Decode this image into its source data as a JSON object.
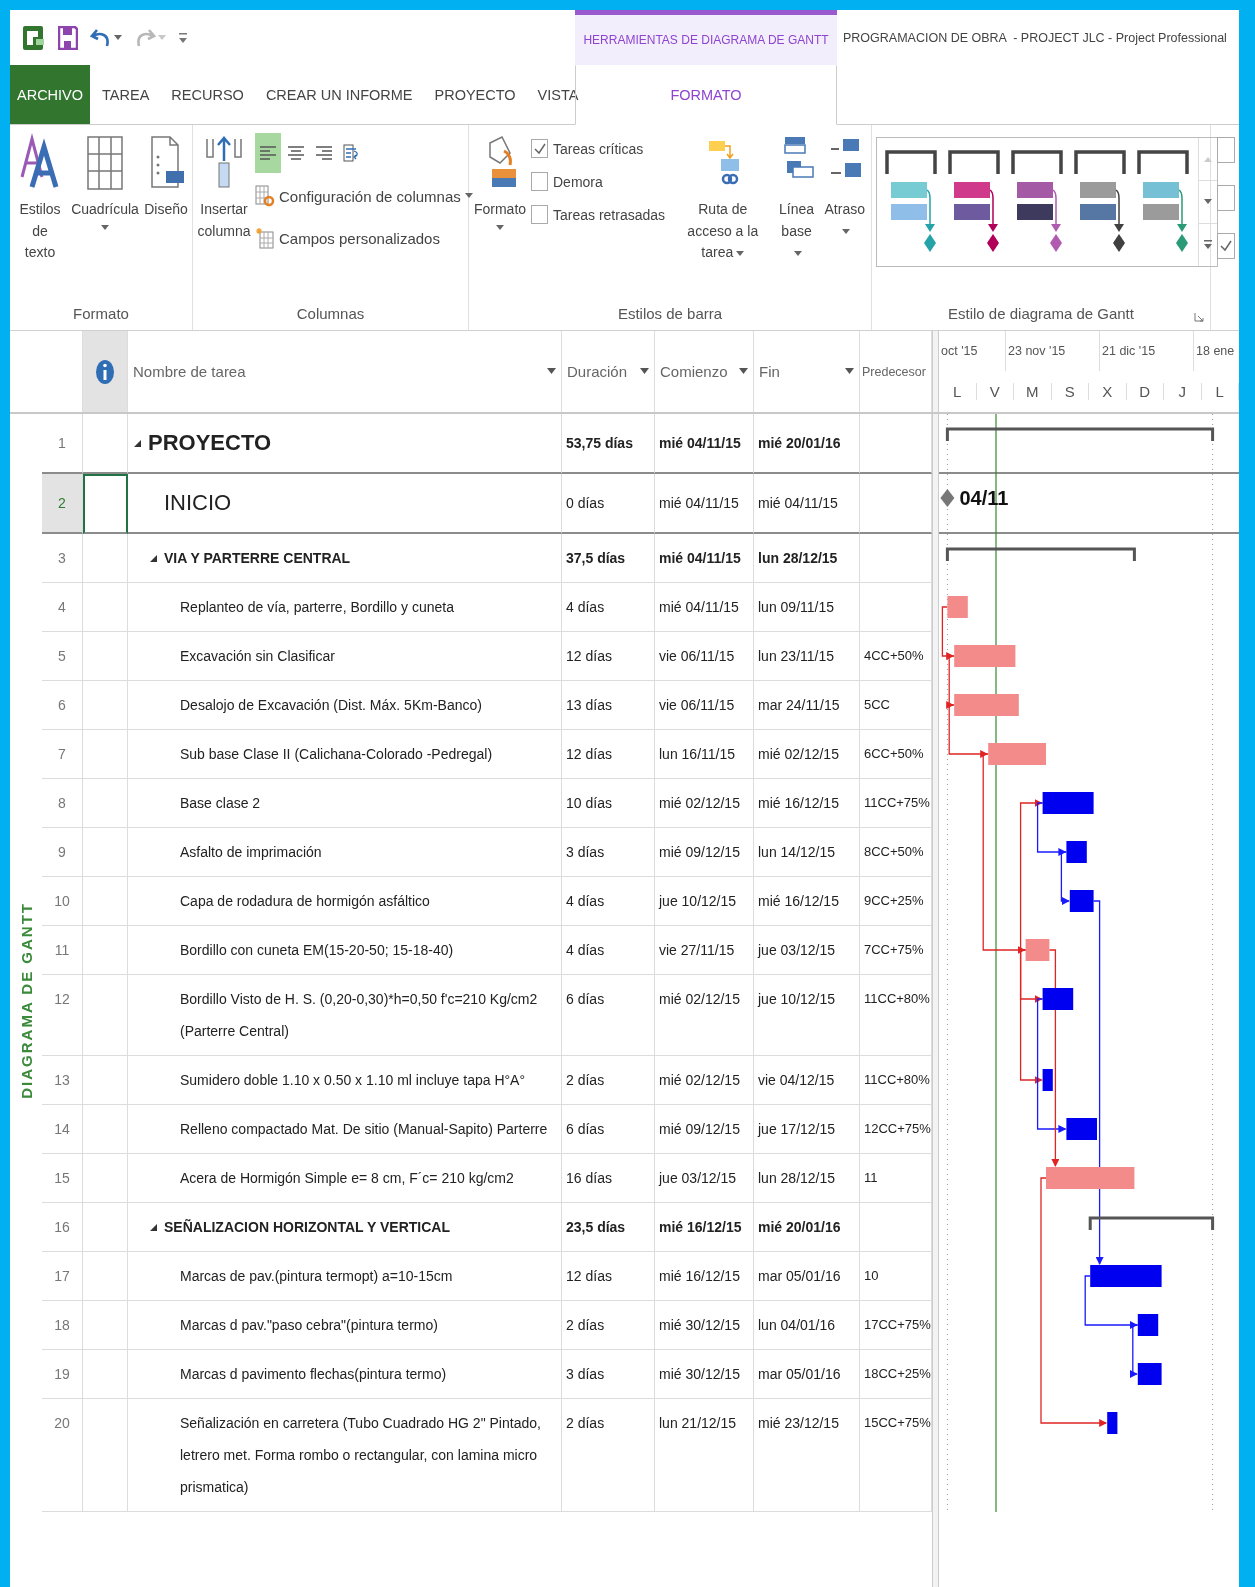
{
  "quick_access_toolbar": {
    "buttons": [
      {
        "kind": "app"
      },
      {
        "kind": "save"
      },
      {
        "kind": "undo",
        "disabled": false
      },
      {
        "kind": "redo",
        "disabled": true
      },
      {
        "kind": "customize"
      }
    ]
  },
  "title_bar": {
    "contextual_group": "HERRAMIENTAS DE DIAGRAMA DE GANTT",
    "title": "PROGRAMACION DE OBRA  - PROJECT JLC - Project Professional"
  },
  "tabs": [
    {
      "label": "ARCHIVO",
      "kind": "file",
      "selected": false
    },
    {
      "label": "TAREA",
      "kind": "standard",
      "selected": false
    },
    {
      "label": "RECURSO",
      "kind": "standard",
      "selected": false
    },
    {
      "label": "CREAR UN INFORME",
      "kind": "standard",
      "selected": false
    },
    {
      "label": "PROYECTO",
      "kind": "standard",
      "selected": false
    },
    {
      "label": "VISTA",
      "kind": "standard",
      "selected": false
    },
    {
      "label": "FORMATO",
      "kind": "contextual",
      "selected": true
    }
  ],
  "ribbon": {
    "format_group": {
      "label": "Formato",
      "buttons": [
        {
          "label": "Estilos de texto",
          "dropdown": false
        },
        {
          "label": "Cuadrícula",
          "dropdown": true
        },
        {
          "label": "Diseño",
          "dropdown": false
        }
      ]
    },
    "columns_group": {
      "label": "Columnas",
      "insert_button": {
        "label": "Insertar columna"
      },
      "align_buttons": [
        {
          "kind": "left",
          "selected": true
        },
        {
          "kind": "center",
          "selected": false
        },
        {
          "kind": "right",
          "selected": false
        },
        {
          "kind": "wrap",
          "selected": false
        }
      ],
      "commands": [
        {
          "label": "Configuración de columnas",
          "dropdown": true
        },
        {
          "label": "Campos personalizados",
          "dropdown": false
        }
      ]
    },
    "bar_styles_group": {
      "label": "Estilos de barra",
      "format_button": {
        "label": "Formato",
        "dropdown": true
      },
      "checkboxes": [
        {
          "label": "Tareas críticas",
          "checked": true
        },
        {
          "label": "Demora",
          "checked": false
        },
        {
          "label": "Tareas retrasadas",
          "checked": false
        }
      ],
      "buttons": [
        {
          "label": "Ruta de acceso a la tarea",
          "dropdown": true
        },
        {
          "label": "Línea base",
          "dropdown": true
        },
        {
          "label": "Atraso",
          "dropdown": true
        }
      ]
    },
    "gantt_style_group": {
      "label": "Estilo de diagrama de Gantt",
      "styles": [
        {
          "swatches": [
            {
              "kind": "task",
              "color": "#76ccd2"
            },
            {
              "kind": "baseline",
              "color": "#8fbfe9"
            },
            {
              "kind": "milestone",
              "color": "#24a3a8"
            }
          ]
        },
        {
          "swatches": [
            {
              "kind": "task",
              "color": "#d03a8a"
            },
            {
              "kind": "baseline",
              "color": "#6e5a9e"
            },
            {
              "kind": "milestone",
              "color": "#b0005a"
            }
          ]
        },
        {
          "swatches": [
            {
              "kind": "task",
              "color": "#a45aa5"
            },
            {
              "kind": "baseline",
              "color": "#3e3a5e"
            },
            {
              "kind": "milestone",
              "color": "#b05ab0"
            }
          ]
        },
        {
          "swatches": [
            {
              "kind": "task",
              "color": "#9b9b9b"
            },
            {
              "kind": "baseline",
              "color": "#5677a3"
            },
            {
              "kind": "milestone",
              "color": "#404040"
            }
          ]
        },
        {
          "swatches": [
            {
              "kind": "task",
              "color": "#76c0d6"
            },
            {
              "kind": "baseline",
              "color": "#9b9b9b"
            },
            {
              "kind": "milestone",
              "color": "#2a9a78"
            }
          ]
        }
      ]
    },
    "overflow_checkboxes": [
      {
        "checked": false
      },
      {
        "checked": false
      },
      {
        "checked": true
      }
    ]
  },
  "view_label": "DIAGRAMA DE GANTT",
  "table": {
    "columns": [
      {
        "label": "Nombre de tarea",
        "filter": true
      },
      {
        "label": "Duración",
        "filter": true
      },
      {
        "label": "Comienzo",
        "filter": true
      },
      {
        "label": "Fin",
        "filter": true
      },
      {
        "label": "Predecesor",
        "filter": false
      }
    ],
    "rows": [
      {
        "id": "1",
        "kind": "summary",
        "large": true,
        "selected": false,
        "name": "PROYECTO",
        "duration": "53,75 días",
        "start": "mié 04/11/15",
        "finish": "mié 20/01/16",
        "children": [
          {
            "id": "2",
            "kind": "milestone",
            "large": true,
            "selected": true,
            "name": "INICIO",
            "duration": "0 días",
            "start": "mié 04/11/15",
            "finish": "mié 04/11/15",
            "gantt_label": "04/11"
          },
          {
            "id": "3",
            "kind": "summary",
            "large": false,
            "selected": false,
            "name": "VIA Y PARTERRE CENTRAL",
            "duration": "37,5 días",
            "start": "mié 04/11/15",
            "finish": "lun 28/12/15",
            "children": [
              {
                "id": "4",
                "kind": "task",
                "critical": true,
                "selected": false,
                "name": "Replanteo de vía, parterre, Bordillo y cuneta",
                "duration": "4 días",
                "start": "mié 04/11/15",
                "finish": "lun 09/11/15"
              },
              {
                "id": "5",
                "kind": "task",
                "critical": true,
                "selected": false,
                "name": "Excavación sin Clasificar",
                "duration": "12 días",
                "start": "vie 06/11/15",
                "finish": "lun 23/11/15",
                "predecessors": "4CC+50%"
              },
              {
                "id": "6",
                "kind": "task",
                "critical": true,
                "selected": false,
                "name": "Desalojo de Excavación (Dist. Máx. 5Km-Banco)",
                "duration": "13 días",
                "start": "vie 06/11/15",
                "finish": "mar 24/11/15",
                "predecessors": "5CC"
              },
              {
                "id": "7",
                "kind": "task",
                "critical": true,
                "selected": false,
                "name": "Sub base Clase II (Calichana-Colorado -Pedregal)",
                "duration": "12 días",
                "start": "lun 16/11/15",
                "finish": "mié 02/12/15",
                "predecessors": "6CC+50%"
              },
              {
                "id": "8",
                "kind": "task",
                "critical": false,
                "selected": false,
                "name": "Base clase 2",
                "duration": "10 días",
                "start": "mié 02/12/15",
                "finish": "mié 16/12/15",
                "predecessors": "11CC+75%"
              },
              {
                "id": "9",
                "kind": "task",
                "critical": false,
                "selected": false,
                "name": "Asfalto de imprimación",
                "duration": "3 días",
                "start": "mié 09/12/15",
                "finish": "lun 14/12/15",
                "predecessors": "8CC+50%"
              },
              {
                "id": "10",
                "kind": "task",
                "critical": false,
                "selected": false,
                "name": "Capa de rodadura de hormigón asfáltico",
                "duration": "4 días",
                "start": "jue 10/12/15",
                "finish": "mié 16/12/15",
                "predecessors": "9CC+25%"
              },
              {
                "id": "11",
                "kind": "task",
                "critical": true,
                "selected": false,
                "name": "Bordillo con cuneta EM(15-20-50; 15-18-40)",
                "duration": "4 días",
                "start": "vie 27/11/15",
                "finish": "jue 03/12/15",
                "predecessors": "7CC+75%"
              },
              {
                "id": "12",
                "kind": "task",
                "critical": false,
                "selected": false,
                "name": "Bordillo Visto de H. S. (0,20-0,30)*h=0,50 f'c=210 Kg/cm2 (Parterre Central)",
                "duration": "6 días",
                "start": "mié 02/12/15",
                "finish": "jue 10/12/15",
                "predecessors": "11CC+80%"
              },
              {
                "id": "13",
                "kind": "task",
                "critical": false,
                "selected": false,
                "name": "Sumidero doble 1.10 x 0.50 x 1.10 ml incluye tapa H°A°",
                "duration": "2 días",
                "start": "mié 02/12/15",
                "finish": "vie 04/12/15",
                "predecessors": "11CC+80%"
              },
              {
                "id": "14",
                "kind": "task",
                "critical": false,
                "selected": false,
                "name": "Relleno compactado Mat. De sitio (Manual-Sapito) Parterre",
                "duration": "6 días",
                "start": "mié 09/12/15",
                "finish": "jue 17/12/15",
                "predecessors": "12CC+75%"
              },
              {
                "id": "15",
                "kind": "task",
                "critical": true,
                "selected": false,
                "name": "Acera de Hormigón Simple e= 8 cm, F´c= 210 kg/cm2",
                "duration": "16 días",
                "start": "jue 03/12/15",
                "finish": "lun 28/12/15",
                "predecessors": "11"
              }
            ]
          },
          {
            "id": "16",
            "kind": "summary",
            "large": false,
            "selected": false,
            "name": "SEÑALIZACION HORIZONTAL Y VERTICAL",
            "duration": "23,5 días",
            "start": "mié 16/12/15",
            "finish": "mié 20/01/16",
            "children": [
              {
                "id": "17",
                "kind": "task",
                "critical": false,
                "selected": false,
                "name": "Marcas de pav.(pintura termopt) a=10-15cm",
                "duration": "12 días",
                "start": "mié 16/12/15",
                "finish": "mar 05/01/16",
                "predecessors": "10"
              },
              {
                "id": "18",
                "kind": "task",
                "critical": false,
                "selected": false,
                "name": "Marcas d pav.\"paso cebra\"(pintura termo)",
                "duration": "2 días",
                "start": "mié 30/12/15",
                "finish": "lun 04/01/16",
                "predecessors": "17CC+75%"
              },
              {
                "id": "19",
                "kind": "task",
                "critical": false,
                "selected": false,
                "name": "Marcas d pavimento flechas(pintura termo)",
                "duration": "3 días",
                "start": "mié 30/12/15",
                "finish": "mar 05/01/16",
                "predecessors": "18CC+25%"
              },
              {
                "id": "20",
                "kind": "task",
                "critical": false,
                "selected": false,
                "name": "Señalización en carretera (Tubo Cuadrado HG 2\" Pintado, letrero met. Forma rombo o rectangular, con lamina micro prismatica)",
                "duration": "2 días",
                "start": "lun 21/12/15",
                "finish": "mié 23/12/15",
                "predecessors": "15CC+75%"
              }
            ]
          }
        ]
      }
    ]
  },
  "timescale": {
    "major": [
      "oct '15",
      "23 nov '15",
      "21 dic '15",
      "18 ene"
    ],
    "minor": [
      "L",
      "V",
      "M",
      "S",
      "X",
      "D",
      "J",
      "L"
    ]
  }
}
